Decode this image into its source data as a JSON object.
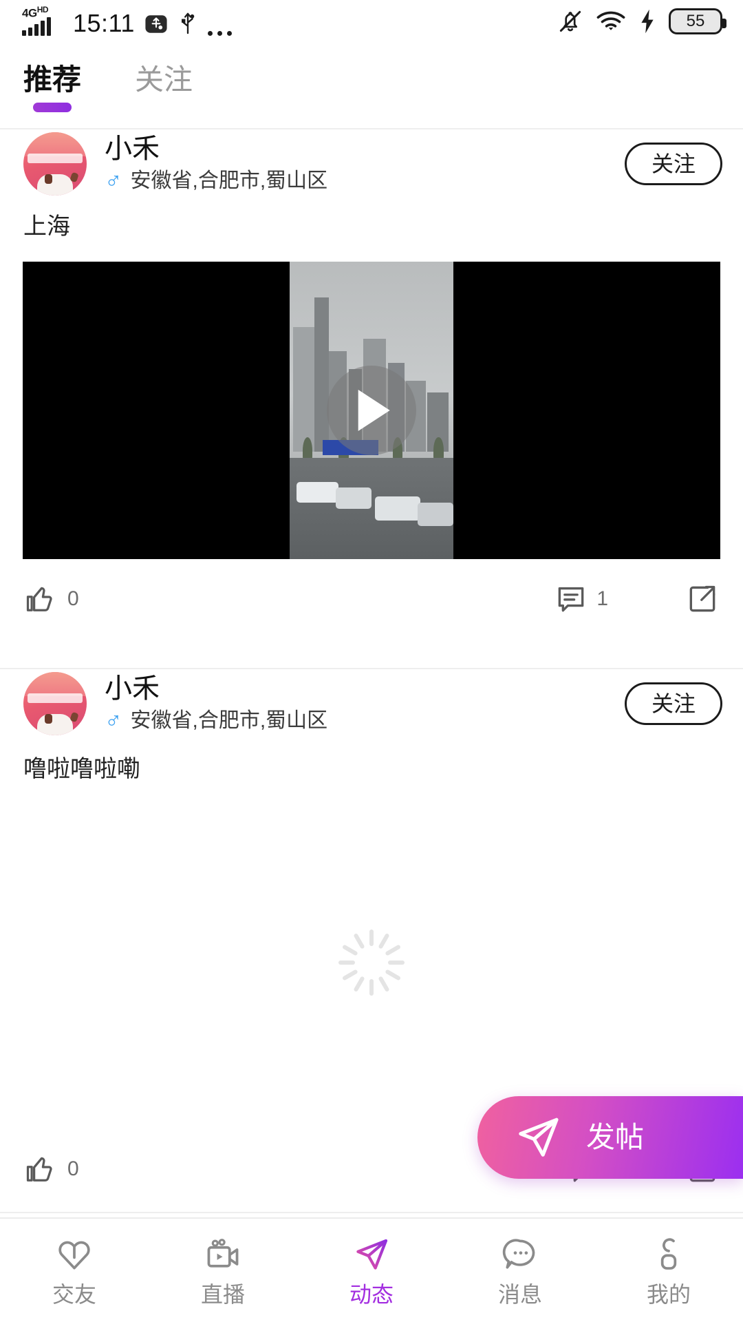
{
  "status_bar": {
    "network": "4G",
    "network_sup": "HD",
    "time": "15:11",
    "usb_debug_icon": "usb-debug-icon",
    "usb_icon": "usb-icon",
    "more_icon": "more-dots-icon",
    "mute_icon": "bell-muted-icon",
    "wifi_icon": "wifi-icon",
    "charging_icon": "charging-bolt-icon",
    "battery_level": "55"
  },
  "top_tabs": [
    {
      "label": "推荐",
      "active": true
    },
    {
      "label": "关注",
      "active": false
    }
  ],
  "posts": [
    {
      "username": "小禾",
      "gender_symbol": "♂",
      "location": "安徽省,合肥市,蜀山区",
      "follow_label": "关注",
      "text": "上海",
      "has_media": true,
      "like_count": "0",
      "comment_count": "1",
      "share_icon": "share-icon",
      "like_icon": "thumbs-up-icon",
      "comment_icon": "comment-icon",
      "play_icon": "play-icon"
    },
    {
      "username": "小禾",
      "gender_symbol": "♂",
      "location": "安徽省,合肥市,蜀山区",
      "follow_label": "关注",
      "text": "噜啦噜啦嘞",
      "has_media": false,
      "like_count": "0",
      "comment_count": "",
      "share_icon": "share-icon",
      "like_icon": "thumbs-up-icon",
      "comment_icon": "comment-icon"
    }
  ],
  "loading": {
    "icon": "loading-spinner-icon"
  },
  "compose_button": {
    "label": "发帖",
    "icon": "send-plane-icon"
  },
  "bottom_nav": [
    {
      "label": "交友",
      "icon": "heart-icon",
      "active": false
    },
    {
      "label": "直播",
      "icon": "live-video-icon",
      "active": false
    },
    {
      "label": "动态",
      "icon": "send-plane-icon",
      "active": true
    },
    {
      "label": "消息",
      "icon": "chat-bubble-icon",
      "active": false
    },
    {
      "label": "我的",
      "icon": "person-icon",
      "active": false
    }
  ],
  "colors": {
    "accent": "#a32ee0",
    "accent_pink": "#f0619f",
    "gender_blue": "#3aa0f0",
    "text_primary": "#111111",
    "text_muted": "#8b8b8b"
  }
}
